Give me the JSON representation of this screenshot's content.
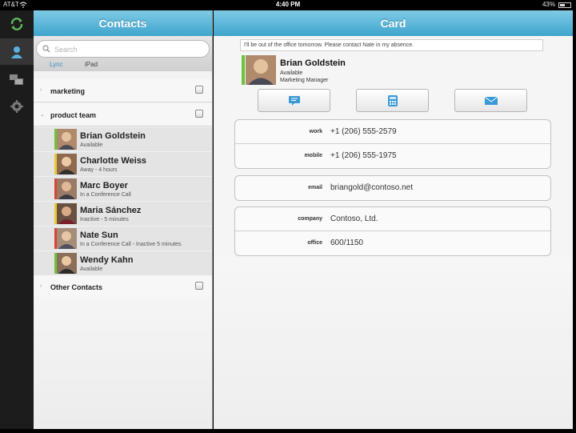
{
  "status_bar": {
    "carrier": "AT&T",
    "time": "4:40 PM",
    "battery": "43%"
  },
  "rail": {
    "items": [
      {
        "icon": "refresh-icon"
      },
      {
        "icon": "contacts-icon"
      },
      {
        "icon": "chat-icon"
      },
      {
        "icon": "settings-icon"
      }
    ]
  },
  "contacts": {
    "title": "Contacts",
    "search_placeholder": "Search",
    "segments": [
      "Lync",
      "iPad"
    ],
    "groups": [
      {
        "label": "marketing",
        "expanded": false
      },
      {
        "label": "product team",
        "expanded": true
      },
      {
        "label": "Other Contacts",
        "expanded": false
      }
    ],
    "people": [
      {
        "name": "Brian Goldstein",
        "status": "Available",
        "presence_color": "#6ec33d"
      },
      {
        "name": "Charlotte Weiss",
        "status": "Away - 4 hours",
        "presence_color": "#e8c933"
      },
      {
        "name": "Marc Boyer",
        "status": "In a Conference Call",
        "presence_color": "#d8443a"
      },
      {
        "name": "Maria Sánchez",
        "status": "Inactive - 5 minutes",
        "presence_color": "#e8c933"
      },
      {
        "name": "Nate Sun",
        "status": "In a Conference Call - Inactive 5 minutes",
        "presence_color": "#d8443a"
      },
      {
        "name": "Wendy Kahn",
        "status": "Available",
        "presence_color": "#6ec33d"
      }
    ]
  },
  "card": {
    "title": "Card",
    "note": "I'll be out of the office tomorrow. Please contact Nate in my absence.",
    "name": "Brian Goldstein",
    "availability": "Available",
    "job_title": "Marketing Manager",
    "actions": [
      {
        "icon": "chat-bubble-icon"
      },
      {
        "icon": "phone-icon"
      },
      {
        "icon": "mail-icon"
      }
    ],
    "phones": [
      {
        "key": "work",
        "value": "+1 (206) 555-2579"
      },
      {
        "key": "mobile",
        "value": "+1 (206) 555-1975"
      }
    ],
    "email": {
      "key": "email",
      "value": "briangold@contoso.net"
    },
    "org": [
      {
        "key": "company",
        "value": "Contoso, Ltd."
      },
      {
        "key": "office",
        "value": "600/1150"
      }
    ]
  },
  "colors": {
    "header_top": "#7fcbe6",
    "header_bottom": "#3fa4cc",
    "accent": "#3a8bc1"
  }
}
